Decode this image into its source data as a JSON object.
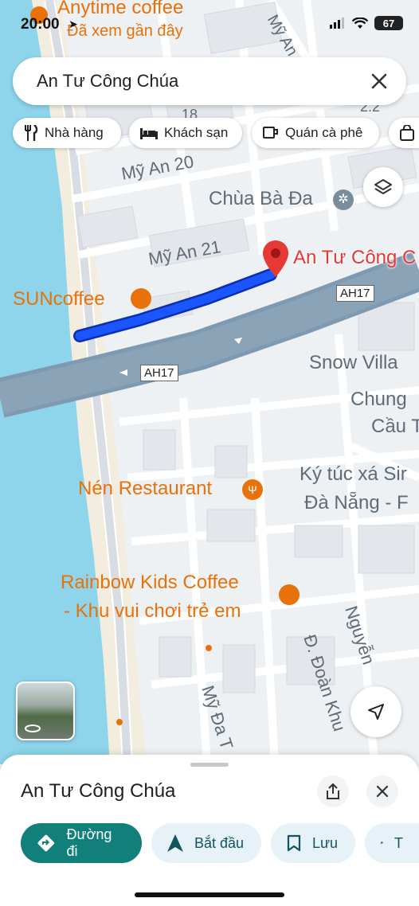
{
  "status": {
    "time": "20:00",
    "battery": "67"
  },
  "search": {
    "query": "An Tư Công Chúa"
  },
  "chips": [
    {
      "label": "Nhà hàng",
      "icon": "fork-knife-icon"
    },
    {
      "label": "Khách sạn",
      "icon": "bed-icon"
    },
    {
      "label": "Quán cà phê",
      "icon": "coffee-cup-icon"
    },
    {
      "label": "",
      "icon": "shopping-bag-icon"
    }
  ],
  "map": {
    "top_poi_title": "Anytime coffee",
    "top_poi_sub": "Đã xem gần đây",
    "streets": {
      "my_an_top": "Mỹ An",
      "my_an_20": "Mỹ An 20",
      "my_an_21": "Mỹ An 21",
      "my_da_tay": "Mỹ Đa T",
      "doan_khue": "Đ. Đoàn Khu",
      "nguyen": "Nguyễn",
      "partial_18": "18",
      "partial_22": "2.2"
    },
    "pin_label": "An Tư Công C",
    "route_shields": [
      "AH17",
      "AH17"
    ],
    "pois": {
      "chua_ba_da": "Chùa Bà Đa",
      "suncoffee": "SUNcoffee",
      "snow_villa": "Snow Villa",
      "chung_cau_1": "Chung",
      "chung_cau_2": "Cầu T",
      "nen_restaurant": "Nén Restaurant",
      "ky_tuc_xa_1": "Ký túc xá Sir",
      "ky_tuc_xa_2": "Đà Nẵng - F",
      "rainbow_1": "Rainbow Kids Coffee",
      "rainbow_2": "- Khu vui chơi trẻ em"
    }
  },
  "sheet": {
    "title": "An Tư Công Chúa",
    "actions": [
      {
        "label": "Đường đi",
        "icon": "directions-icon",
        "primary": true
      },
      {
        "label": "Bắt đầu",
        "icon": "navigation-arrow-icon",
        "primary": false
      },
      {
        "label": "Lưu",
        "icon": "bookmark-icon",
        "primary": false
      },
      {
        "label": "T",
        "icon": "flag-icon",
        "primary": false
      }
    ]
  },
  "colors": {
    "sea": "#8ed4ea",
    "beach": "#f3ede0",
    "highway": "#7f9ab0",
    "route": "#1a56ff",
    "poi_orange": "#e8710a",
    "primary_button": "#12807a",
    "secondary_button": "#e6f2f8",
    "pin_red": "#e53935"
  }
}
